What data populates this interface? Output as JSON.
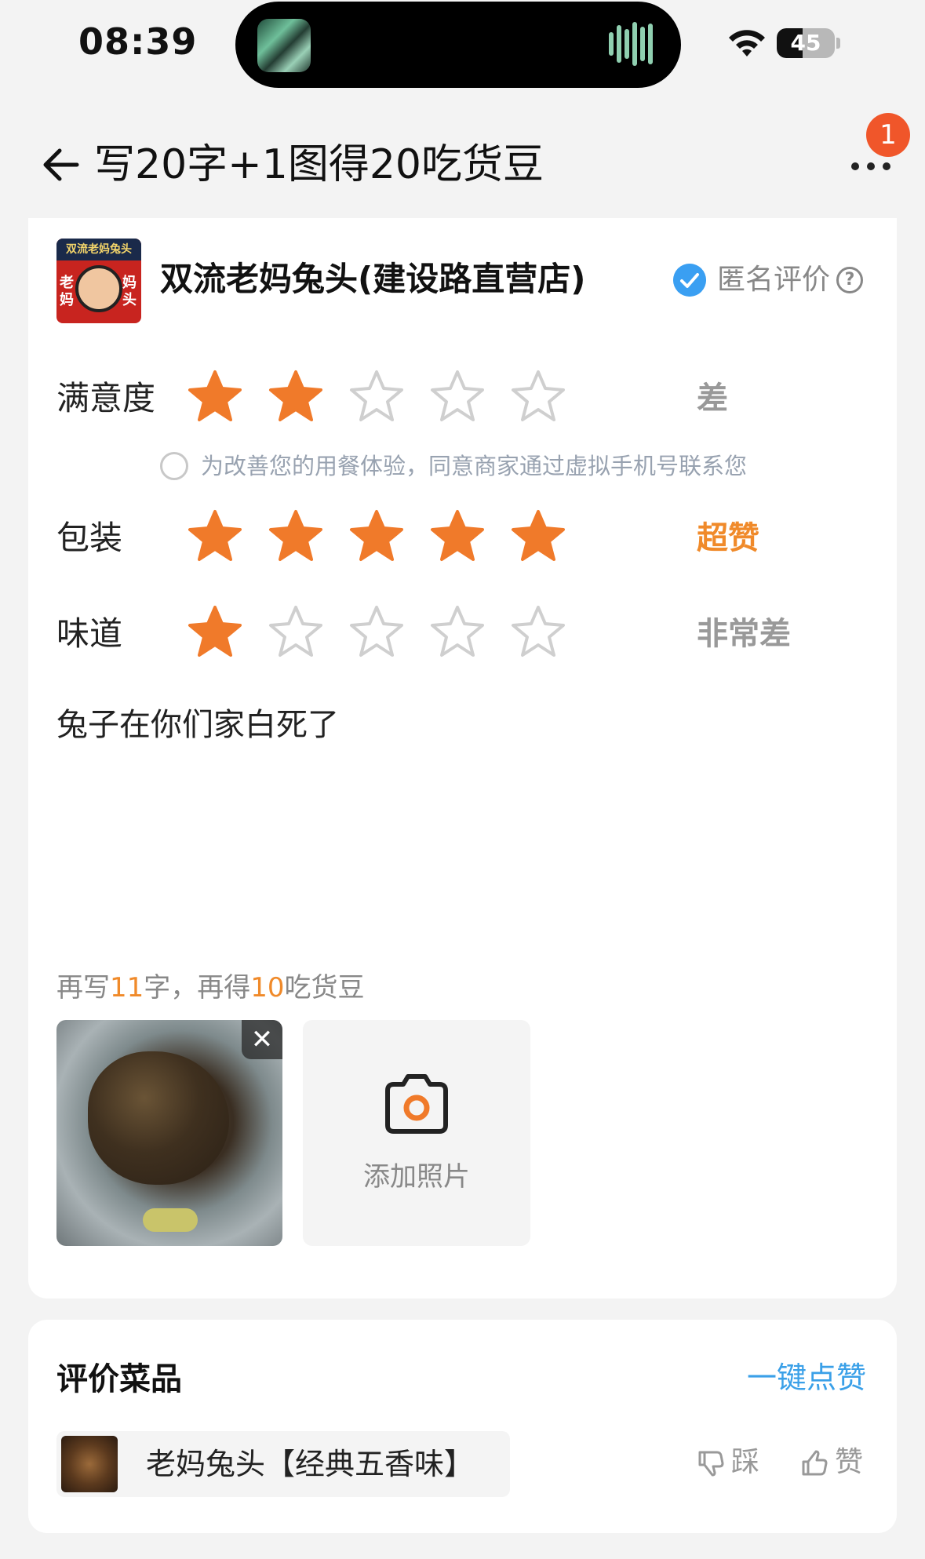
{
  "status_bar": {
    "time": "08:39",
    "battery_percent": 45,
    "battery_label": "45"
  },
  "nav": {
    "title": "写20字+1图得20吃货豆",
    "notification_count": "1"
  },
  "shop": {
    "name": "双流老妈兔头(建设路直营店)",
    "logo_top_text": "双流老妈兔头",
    "logo_left_text": "老妈",
    "logo_right_text": "妈头",
    "anonymous_label": "匿名评价",
    "anonymous_checked": true,
    "help_glyph": "?"
  },
  "ratings": [
    {
      "label": "满意度",
      "score": 2,
      "max": 5,
      "word": "差",
      "word_color": "#999999"
    },
    {
      "label": "包装",
      "score": 5,
      "max": 5,
      "word": "超赞",
      "word_color": "#f08a2a"
    },
    {
      "label": "味道",
      "score": 1,
      "max": 5,
      "word": "非常差",
      "word_color": "#999999"
    }
  ],
  "consent_text": "为改善您的用餐体验，同意商家通过虚拟手机号联系您",
  "review_text": "兔子在你们家白死了",
  "hint": {
    "part1": "再写",
    "num1": "11",
    "part2": "字，再得",
    "num2": "10",
    "part3": "吃货豆"
  },
  "photos": {
    "remove_glyph": "✕",
    "add_label": "添加照片"
  },
  "dish_section": {
    "title": "评价菜品",
    "like_all_label": "一键点赞",
    "items": [
      {
        "name": "老妈兔头【经典五香味】",
        "dislike_label": "踩",
        "like_label": "赞"
      }
    ]
  },
  "colors": {
    "star_filled": "#f07a2a",
    "star_empty_stroke": "#cfcfcf",
    "accent_orange": "#f08a2a",
    "link_blue": "#3aa0e8",
    "check_blue": "#3a9ff2",
    "badge_red": "#f0562a"
  }
}
